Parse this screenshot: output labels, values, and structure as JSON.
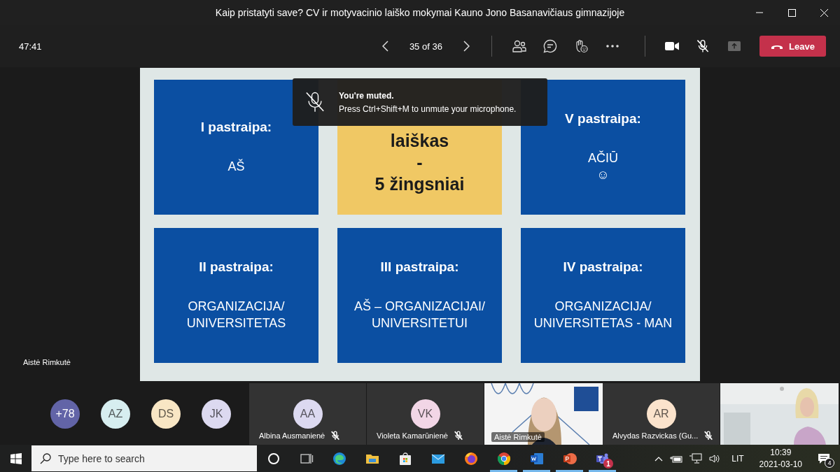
{
  "window": {
    "title": "Kaip pristatyti save? CV ir motyvacinio laiško mokymai Kauno Jono Basanavičiaus gimnazijoje"
  },
  "toolbar": {
    "timer": "47:41",
    "slide_counter": "35 of 36",
    "mic_muted": true,
    "leave_button": "Leave"
  },
  "slide": {
    "cards": [
      {
        "kind": "blue",
        "heading": "I pastraipa:",
        "body": "AŠ"
      },
      {
        "kind": "yellow",
        "body": "laiškas\n-\n5 žingsniai"
      },
      {
        "kind": "blue",
        "heading": "V pastraipa:",
        "body": "AČIŪ\n☺"
      },
      {
        "kind": "blue",
        "heading": "II pastraipa:",
        "body": "ORGANIZACIJA/\nUNIVERSITETAS"
      },
      {
        "kind": "blue",
        "heading": "III pastraipa:",
        "body": "AŠ – ORGANIZACIJAI/\nUNIVERSITETUI"
      },
      {
        "kind": "blue",
        "heading": "IV pastraipa:",
        "body": "ORGANIZACIJA/\nUNIVERSITETAS - MAN"
      }
    ]
  },
  "toast": {
    "title": "You're muted.",
    "message": "Press Ctrl+Shift+M to unmute your microphone."
  },
  "presenter_label": "Aistė Rimkutė",
  "participants": [
    {
      "kind": "avatar",
      "initials": "+78",
      "color": "#6264a7"
    },
    {
      "kind": "avatar",
      "initials": "AZ",
      "color": "#d7eef0"
    },
    {
      "kind": "avatar",
      "initials": "DS",
      "color": "#f8e6c4"
    },
    {
      "kind": "avatar",
      "initials": "JK",
      "color": "#dcd9f0"
    },
    {
      "kind": "tile",
      "initials": "AA",
      "color": "#dcd9f0",
      "name": "Albina Ausmanienė",
      "muted": true
    },
    {
      "kind": "tile",
      "initials": "VK",
      "color": "#f2d6e6",
      "name": "Violeta Kamarūnienė",
      "muted": true
    },
    {
      "kind": "video",
      "name": "Aistė Rimkutė"
    },
    {
      "kind": "tile",
      "initials": "AR",
      "color": "#fbe3cc",
      "name": "Alvydas Razvickas (Gu...",
      "muted": true
    },
    {
      "kind": "video"
    }
  ],
  "taskbar": {
    "search_placeholder": "Type here to search",
    "apps": [
      {
        "kind": "cortana",
        "running": false
      },
      {
        "kind": "taskview",
        "running": false
      },
      {
        "kind": "edge",
        "running": false
      },
      {
        "kind": "explorer",
        "running": false
      },
      {
        "kind": "store",
        "running": false
      },
      {
        "kind": "mail",
        "running": false
      },
      {
        "kind": "firefox",
        "running": false
      },
      {
        "kind": "chrome",
        "running": true
      },
      {
        "kind": "word",
        "running": true
      },
      {
        "kind": "powerpoint",
        "running": true
      },
      {
        "kind": "teams",
        "running": true,
        "badge": "1"
      }
    ],
    "language": "LIT",
    "time": "10:39",
    "date": "2021-03-10",
    "notifications": "4"
  }
}
